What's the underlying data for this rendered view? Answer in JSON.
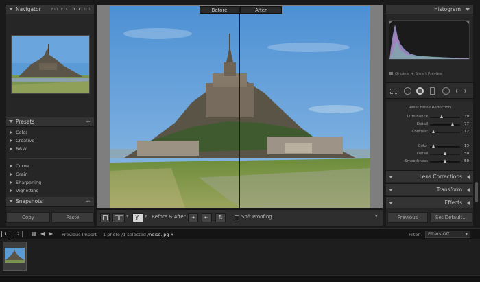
{
  "navigator": {
    "title": "Navigator",
    "zoom_options": [
      "FIT",
      "FILL",
      "1:1",
      "3:1"
    ]
  },
  "presets": {
    "title": "Presets",
    "groups_top": [
      "Color",
      "Creative",
      "B&W"
    ],
    "groups_bottom": [
      "Curve",
      "Grain",
      "Sharpening",
      "Vignetting"
    ]
  },
  "snapshots": {
    "title": "Snapshots"
  },
  "left_buttons": {
    "copy": "Copy",
    "paste": "Paste"
  },
  "before_after": {
    "before": "Before",
    "after": "After"
  },
  "toolbar": {
    "before_after_label": "Before & After :",
    "soft_proofing": "Soft Proofing"
  },
  "histogram": {
    "title": "Histogram",
    "preview_label": "Original + Smart Preview"
  },
  "noise_reduction": {
    "reset_label": "Reset Noise Reduction",
    "luminance": {
      "label": "Luminance",
      "value": "39",
      "level": 0.39
    },
    "detail1": {
      "label": "Detail",
      "value": "77",
      "level": 0.77
    },
    "contrast": {
      "label": "Contrast",
      "value": "12",
      "level": 0.12
    },
    "color": {
      "label": "Color",
      "value": "13",
      "level": 0.13
    },
    "detail2": {
      "label": "Detail",
      "value": "50",
      "level": 0.5
    },
    "smoothness": {
      "label": "Smoothness",
      "value": "50",
      "level": 0.5
    }
  },
  "right_sections": {
    "lens_corrections": "Lens Corrections",
    "transform": "Transform",
    "effects": "Effects"
  },
  "right_buttons": {
    "previous": "Previous",
    "set_default": "Set Default..."
  },
  "filmbar": {
    "page1": "1",
    "page2": "2",
    "source": "Previous Import",
    "selection": "1 photo /1 selected /",
    "filename": "noise.jpg",
    "filter_label": "Filter :",
    "filter_value": "Filters Off"
  },
  "colors": {
    "panel_bg": "#262626",
    "header_bg": "#333333",
    "center_bg": "#7e7e7e",
    "sky": "#5b9bd5",
    "grass": "#6f8a3f"
  }
}
